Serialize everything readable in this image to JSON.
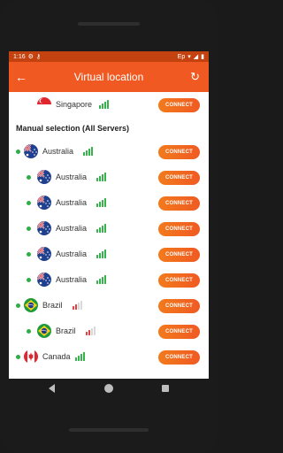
{
  "status_bar": {
    "time": "1:16",
    "carrier": "Ep"
  },
  "app_bar": {
    "title": "Virtual location"
  },
  "top_server": {
    "name": "Singapore",
    "button": "CONNECT",
    "flag": "singapore",
    "signal": "green"
  },
  "section": {
    "title": "Manual selection (All Servers)"
  },
  "servers": [
    {
      "name": "Australia",
      "button": "CONNECT",
      "flag": "australia",
      "signal": "green",
      "level": "country"
    },
    {
      "name": "Australia",
      "button": "CONNECT",
      "flag": "australia",
      "signal": "green",
      "level": "city"
    },
    {
      "name": "Australia",
      "button": "CONNECT",
      "flag": "australia",
      "signal": "green",
      "level": "city"
    },
    {
      "name": "Australia",
      "button": "CONNECT",
      "flag": "australia",
      "signal": "green",
      "level": "city"
    },
    {
      "name": "Australia",
      "button": "CONNECT",
      "flag": "australia",
      "signal": "green",
      "level": "city"
    },
    {
      "name": "Australia",
      "button": "CONNECT",
      "flag": "australia",
      "signal": "green",
      "level": "city"
    },
    {
      "name": "Brazil",
      "button": "CONNECT",
      "flag": "brazil",
      "signal": "red",
      "level": "country"
    },
    {
      "name": "Brazil",
      "button": "CONNECT",
      "flag": "brazil",
      "signal": "red",
      "level": "city"
    },
    {
      "name": "Canada",
      "button": "CONNECT",
      "flag": "canada",
      "signal": "green",
      "level": "country"
    }
  ],
  "colors": {
    "accent": "#f05a22",
    "status_bar": "#c4420f",
    "online_dot": "#2fae48"
  }
}
